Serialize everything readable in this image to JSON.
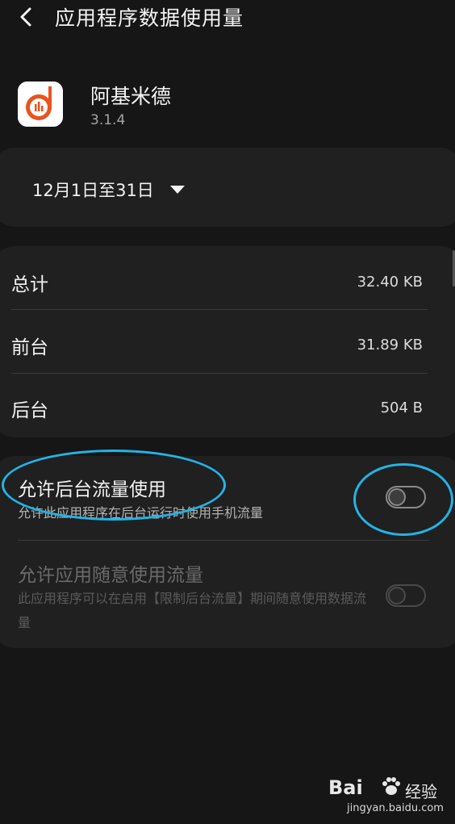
{
  "header": {
    "title": "应用程序数据使用量",
    "back_icon": "back-arrow-icon"
  },
  "app": {
    "name": "阿基米德",
    "version": "3.1.4",
    "icon": "archimedes-app-icon",
    "brand_color": "#e9531e"
  },
  "date_range": {
    "label": "12月1日至31日",
    "icon": "dropdown-triangle-icon"
  },
  "usage": [
    {
      "label": "总计",
      "value": "32.40 KB"
    },
    {
      "label": "前台",
      "value": "31.89 KB"
    },
    {
      "label": "后台",
      "value": "504 B"
    }
  ],
  "settings": [
    {
      "title": "允许后台流量使用",
      "description": "允许此应用程序在后台运行时使用手机流量",
      "enabled": false,
      "disabled": false
    },
    {
      "title": "允许应用随意使用流量",
      "description": "此应用程序可以在启用【限制后台流量】期间随意使用数据流量",
      "enabled": false,
      "disabled": true
    }
  ],
  "annotation_color": "#22b4e6",
  "watermark": {
    "logo": "Bai",
    "logo_suffix": "经验",
    "url": "jingyan.baidu.com"
  }
}
